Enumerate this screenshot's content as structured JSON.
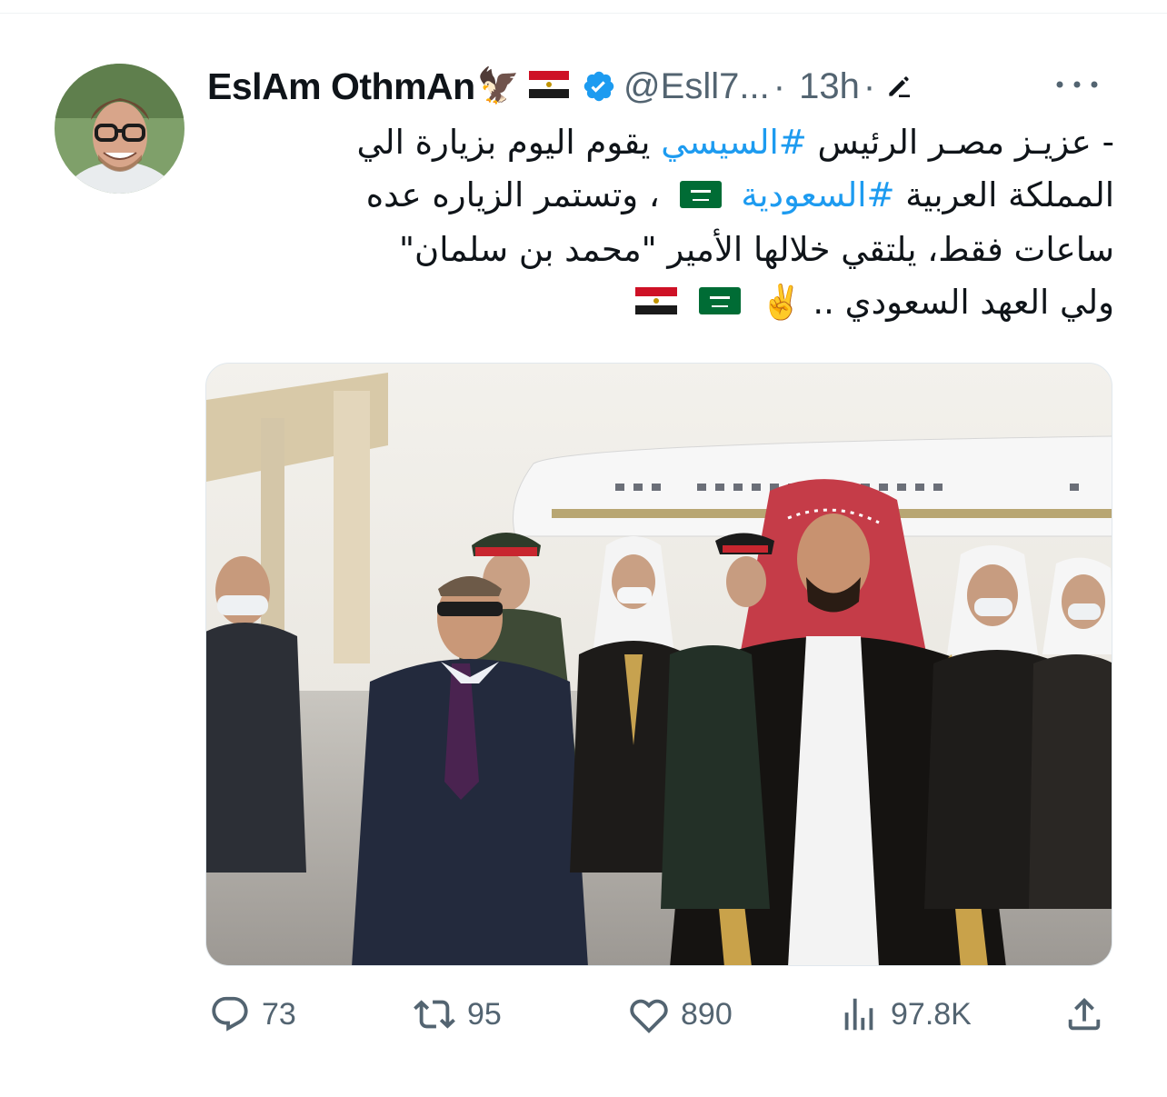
{
  "tweet": {
    "author": {
      "display_name": "EslAm OthmAn",
      "name_emoji": "🦅",
      "handle": "@Esll7...",
      "verified": true
    },
    "time": "13h",
    "separator": "·",
    "text": {
      "line1_prefix": "- عزيـز مصـر الرئيس ",
      "hashtag1": "#السيسي",
      "line1_suffix": " يقوم اليوم بزيارة الي",
      "line2_prefix": "المملكة العربية ",
      "hashtag2": "#السعودية",
      "line2_suffix": " ، وتستمر الزياره عده",
      "line3": "ساعات فقط، يلتقي خلالها الأمير \"محمد بن سلمان\"",
      "line4": "ولي العهد السعودي .. ",
      "victory_emoji": "✌️"
    },
    "stats": {
      "replies": "73",
      "reposts": "95",
      "likes": "890",
      "views": "97.8K"
    }
  },
  "icons": [
    "verified-badge-icon",
    "edit-icon",
    "more-icon",
    "reply-icon",
    "repost-icon",
    "like-icon",
    "views-icon",
    "share-icon",
    "egypt-flag-icon",
    "saudi-flag-icon",
    "eagle-icon"
  ],
  "colors": {
    "accent": "#1d9bf0",
    "text": "#0f1419",
    "secondary": "#536471",
    "egypt_red": "#ce1126",
    "saudi_green": "#006c35"
  }
}
